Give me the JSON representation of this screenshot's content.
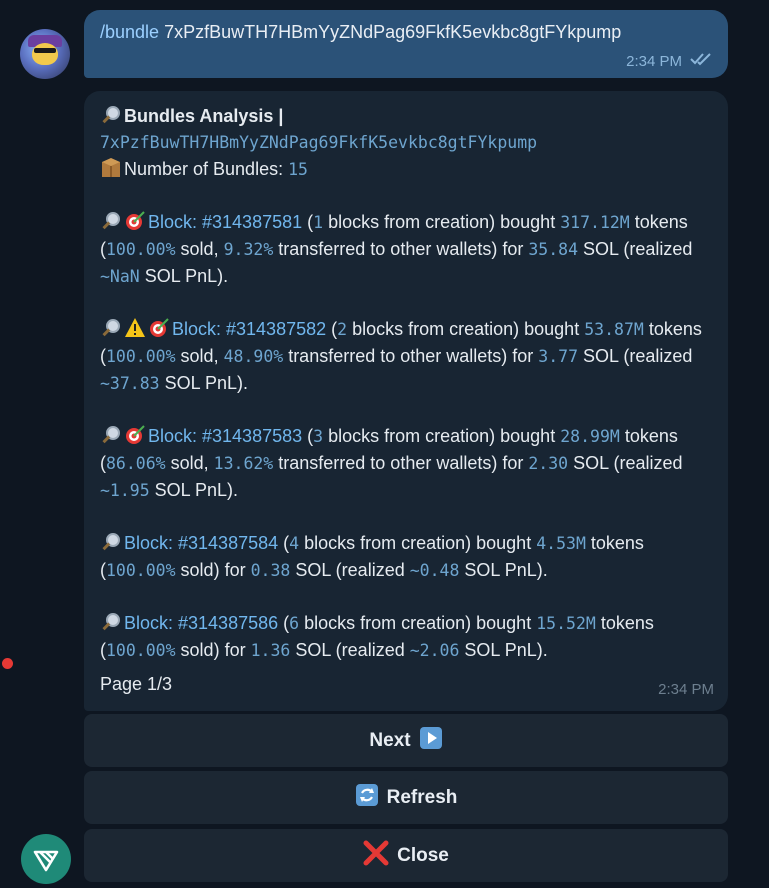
{
  "user_message": {
    "command": "/bundle",
    "argument": "7xPzfBuwTH7HBmYyZNdPag69FkfK5evkbc8gtFYkpump",
    "time": "2:34 PM"
  },
  "bot_message": {
    "title": "Bundles Analysis |",
    "address": "7xPzfBuwTH7HBmYyZNdPag69FkfK5evkbc8gtFYkpump",
    "bundles_label": "Number of Bundles:",
    "bundles_count": "15",
    "time": "2:34 PM",
    "page": "Page 1/3",
    "blocks": [
      {
        "block": "Block: #314387581",
        "blocks_from_creation": "1",
        "bought": "317.12M",
        "sold_pct": "100.00%",
        "transferred_pct": "9.32%",
        "for_sol": "35.84",
        "pnl": "~NaN",
        "warning": false
      },
      {
        "block": "Block: #314387582",
        "blocks_from_creation": "2",
        "bought": "53.87M",
        "sold_pct": "100.00%",
        "transferred_pct": "48.90%",
        "for_sol": "3.77",
        "pnl": "~37.83",
        "warning": true
      },
      {
        "block": "Block: #314387583",
        "blocks_from_creation": "3",
        "bought": "28.99M",
        "sold_pct": "86.06%",
        "transferred_pct": "13.62%",
        "for_sol": "2.30",
        "pnl": "~1.95",
        "warning": false
      },
      {
        "block": "Block: #314387584",
        "blocks_from_creation": "4",
        "bought": "4.53M",
        "sold_pct": "100.00%",
        "for_sol": "0.38",
        "pnl": "~0.48"
      },
      {
        "block": "Block: #314387586",
        "blocks_from_creation": "6",
        "bought": "15.52M",
        "sold_pct": "100.00%",
        "for_sol": "1.36",
        "pnl": "~2.06"
      }
    ],
    "text": {
      "open_paren": "(",
      "blocks_from_creation_bought": " blocks from creation) bought ",
      "tokens_open": " tokens (",
      "sold_comma": " sold, ",
      "transferred_for": " transferred to other wallets) for ",
      "sold_for": " sold) for ",
      "sol_realized": " SOL (realized ",
      "sol_pnl": " SOL PnL)."
    }
  },
  "buttons": {
    "next": "Next",
    "refresh": "Refresh",
    "close": "Close"
  },
  "colors": {
    "background": "#0e1621",
    "user_bubble": "#2b5278",
    "bot_bubble": "#182533",
    "link": "#71b7ee",
    "mono_value": "#6ea5cf",
    "button": "#1c2733",
    "close_x": "#e53935"
  }
}
